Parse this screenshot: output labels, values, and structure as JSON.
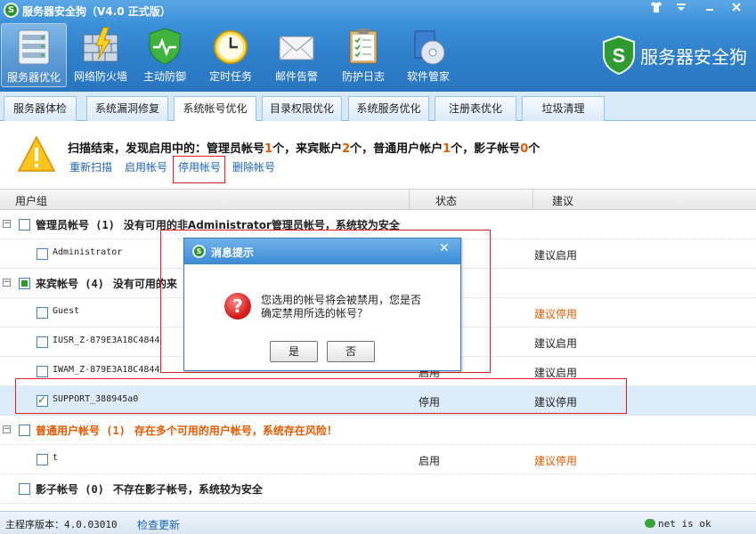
{
  "app": {
    "title": "服务器安全狗（V4.0 正式版）",
    "logo_letter": "S",
    "brand_name": "服务器安全狗"
  },
  "window_controls": [
    "shirt-icon",
    "menu-icon",
    "minimize-icon",
    "close-icon"
  ],
  "toolbar": [
    {
      "label": "服务器优化",
      "icon": "server-icon",
      "active": true
    },
    {
      "label": "网络防火墙",
      "icon": "firewall-icon"
    },
    {
      "label": "主动防御",
      "icon": "shield-icon"
    },
    {
      "label": "定时任务",
      "icon": "clock-icon"
    },
    {
      "label": "邮件告警",
      "icon": "mail-icon"
    },
    {
      "label": "防护日志",
      "icon": "log-icon"
    },
    {
      "label": "软件管家",
      "icon": "software-icon"
    }
  ],
  "tabs": [
    {
      "label": "服务器体检"
    },
    {
      "label": "系统漏洞修复"
    },
    {
      "label": "系统帐号优化",
      "active": true
    },
    {
      "label": "目录权限优化"
    },
    {
      "label": "系统服务优化"
    },
    {
      "label": "注册表优化"
    },
    {
      "label": "垃圾清理"
    }
  ],
  "scan": {
    "prefix": "扫描结束，发现启用中的：管理员帐号",
    "admin_count": "1",
    "guest_prefix": "个，来宾账户",
    "guest_count": "2",
    "normal_prefix": "个，普通用户帐户",
    "normal_count": "1",
    "shadow_prefix": "个，影子帐号",
    "shadow_count": "0",
    "suffix": "个"
  },
  "actions": {
    "rescan": "重新扫描",
    "enable": "启用帐号",
    "disable": "停用帐号",
    "delete": "删除帐号"
  },
  "table": {
    "headers": {
      "group": "用户组",
      "status": "状态",
      "advice": "建议"
    },
    "groups": [
      {
        "name": "管理员帐号 (1)",
        "note": "没有可用的非Administrator管理员帐号，系统较为安全",
        "expander": "−",
        "state": "unchecked",
        "orange": false
      },
      {
        "name": "来宾帐号 (4)",
        "note": "没有可用的来",
        "expander": "−",
        "state": "partial",
        "orange": false
      },
      {
        "name": "普通用户帐号 (1)",
        "note": "存在多个可用的用户帐号，系统存在风险！",
        "expander": "−",
        "state": "unchecked",
        "orange": true
      },
      {
        "name": "影子帐号 (0)",
        "note": "不存在影子帐号，系统较为安全",
        "expander": "",
        "state": "unchecked",
        "orange": false
      }
    ],
    "accounts": [
      {
        "name": "Administrator",
        "status": "",
        "advice": "建议启用",
        "warn": false,
        "checked": false
      },
      {
        "name": "Guest",
        "status": "",
        "advice": "建议停用",
        "warn": true,
        "checked": false
      },
      {
        "name": "IUSR_Z-879E3A18C4844",
        "status": "",
        "advice": "建议启用",
        "warn": false,
        "checked": false
      },
      {
        "name": "IWAM_Z-879E3A18C4844",
        "status": "启用",
        "advice": "建议启用",
        "warn": false,
        "checked": false
      },
      {
        "name": "SUPPORT_388945a0",
        "status": "停用",
        "advice": "建议停用",
        "warn": false,
        "checked": true
      },
      {
        "name": "t",
        "status": "启用",
        "advice": "建议停用",
        "warn": true,
        "checked": false
      }
    ]
  },
  "dialog": {
    "title": "消息提示",
    "line1": "您选用的帐号将会被禁用，您是否",
    "line2": "确定禁用所选的帐号？",
    "yes": "是",
    "no": "否"
  },
  "statusbar": {
    "version": "主程序版本：4.0.03010",
    "check_update": "检查更新",
    "net": "net is ok"
  },
  "colors": {
    "title_blue": "#3b8fd8",
    "warn_orange": "#e05a00",
    "annotation_red": "#e02020",
    "link_blue": "#1e63b0"
  }
}
